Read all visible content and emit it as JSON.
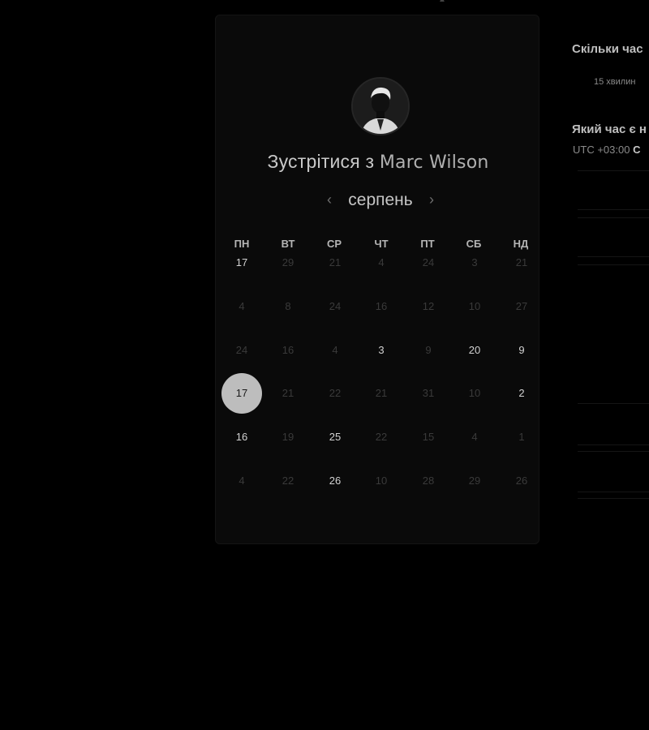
{
  "header": {
    "title_prefix": "Зустрітися з",
    "host_name": "Marc Wilson"
  },
  "calendar": {
    "month": "серпень",
    "prev_label": "‹",
    "next_label": "›",
    "weekdays": [
      "ПН",
      "ВТ",
      "СР",
      "ЧТ",
      "ПТ",
      "СБ",
      "НД"
    ],
    "weeks": [
      [
        {
          "d": "17",
          "a": true
        },
        {
          "d": "29",
          "a": false
        },
        {
          "d": "21",
          "a": false
        },
        {
          "d": "4",
          "a": false
        },
        {
          "d": "24",
          "a": false
        },
        {
          "d": "3",
          "a": false
        },
        {
          "d": "21",
          "a": false
        }
      ],
      [
        {
          "d": "4",
          "a": false
        },
        {
          "d": "8",
          "a": false
        },
        {
          "d": "24",
          "a": false
        },
        {
          "d": "16",
          "a": false
        },
        {
          "d": "12",
          "a": false
        },
        {
          "d": "10",
          "a": false
        },
        {
          "d": "27",
          "a": false
        }
      ],
      [
        {
          "d": "24",
          "a": false
        },
        {
          "d": "16",
          "a": false
        },
        {
          "d": "4",
          "a": false
        },
        {
          "d": "3",
          "a": true
        },
        {
          "d": "9",
          "a": false
        },
        {
          "d": "20",
          "a": true
        },
        {
          "d": "9",
          "a": true
        }
      ],
      [
        {
          "d": "17",
          "a": true,
          "s": true
        },
        {
          "d": "21",
          "a": false
        },
        {
          "d": "22",
          "a": false
        },
        {
          "d": "21",
          "a": false
        },
        {
          "d": "31",
          "a": false
        },
        {
          "d": "10",
          "a": false
        },
        {
          "d": "2",
          "a": true
        }
      ],
      [
        {
          "d": "16",
          "a": true
        },
        {
          "d": "19",
          "a": false
        },
        {
          "d": "25",
          "a": true
        },
        {
          "d": "22",
          "a": false
        },
        {
          "d": "15",
          "a": false
        },
        {
          "d": "4",
          "a": false
        },
        {
          "d": "1",
          "a": false
        }
      ],
      [
        {
          "d": "4",
          "a": false
        },
        {
          "d": "22",
          "a": false
        },
        {
          "d": "26",
          "a": true
        },
        {
          "d": "10",
          "a": false
        },
        {
          "d": "28",
          "a": false
        },
        {
          "d": "29",
          "a": false
        },
        {
          "d": "26",
          "a": false
        }
      ]
    ]
  },
  "side": {
    "duration_question": "Скільки час",
    "duration_option": "15 хвилин",
    "time_question": "Який час є н",
    "timezone_prefix": "UTC +03:00",
    "timezone_suffix": "С"
  },
  "colors": {
    "background": "#000000",
    "card": "#0a0a0a",
    "selected_day": "#bdbdbd"
  }
}
